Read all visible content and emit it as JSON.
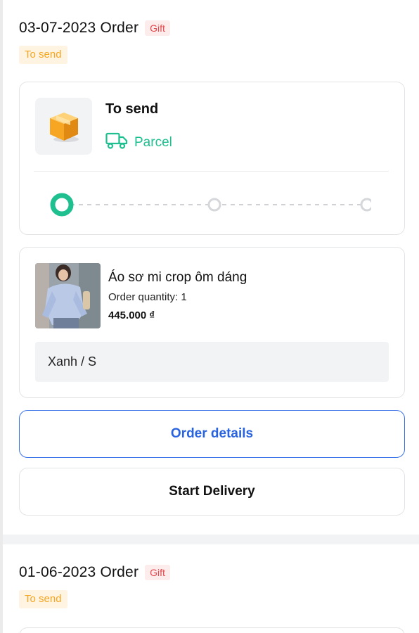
{
  "orders": [
    {
      "title": "03-07-2023 Order",
      "gift_badge": "Gift",
      "status_tag": "To send",
      "shipping": {
        "status": "To send",
        "method": "Parcel",
        "progress_step": 1,
        "progress_total": 3
      },
      "item": {
        "name": "Áo sơ mi crop ôm dáng",
        "quantity_label": "Order quantity: 1",
        "price": "445.000 ₫",
        "variant": "Xanh / S"
      },
      "buttons": {
        "details": "Order details",
        "start_delivery": "Start Delivery"
      }
    },
    {
      "title": "01-06-2023 Order",
      "gift_badge": "Gift",
      "status_tag": "To send"
    }
  ],
  "colors": {
    "accent_green": "#1fbf8f",
    "accent_blue": "#2a63df",
    "gift_red": "#e5484d",
    "status_orange": "#f5a623",
    "box_orange": "#f6a623"
  },
  "icons": {
    "box": "box-icon",
    "truck": "truck-icon"
  }
}
